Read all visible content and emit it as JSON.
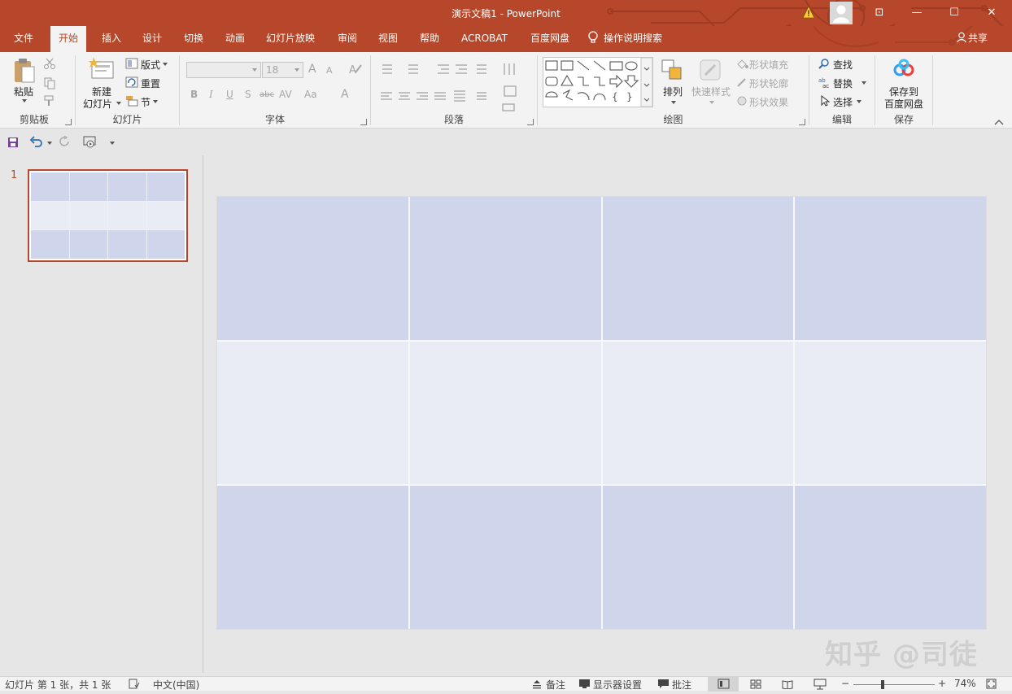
{
  "window": {
    "title": "演示文稿1  -  PowerPoint",
    "minimize": "—",
    "restore": "☐",
    "close": "✕",
    "ribbon_display": "⊡"
  },
  "tabs": [
    {
      "label": "文件",
      "active": false
    },
    {
      "label": "开始",
      "active": true
    },
    {
      "label": "插入",
      "active": false
    },
    {
      "label": "设计",
      "active": false
    },
    {
      "label": "切换",
      "active": false
    },
    {
      "label": "动画",
      "active": false
    },
    {
      "label": "幻灯片放映",
      "active": false
    },
    {
      "label": "审阅",
      "active": false
    },
    {
      "label": "视图",
      "active": false
    },
    {
      "label": "帮助",
      "active": false
    },
    {
      "label": "ACROBAT",
      "active": false
    },
    {
      "label": "百度网盘",
      "active": false
    }
  ],
  "tell_me": "操作说明搜索",
  "share": "共享",
  "ribbon": {
    "clipboard": {
      "paste": "粘贴",
      "group": "剪贴板"
    },
    "slides": {
      "new_slide": "新建",
      "new_slide2": "幻灯片",
      "layout": "版式",
      "reset": "重置",
      "section": "节",
      "group": "幻灯片"
    },
    "font": {
      "size": "18",
      "group": "字体",
      "bold": "B",
      "italic": "I",
      "underline": "U",
      "shadow": "S",
      "strike": "abc",
      "spacing": "AV",
      "case": "Aa",
      "grow": "A",
      "shrink": "A",
      "color": "A"
    },
    "paragraph": {
      "group": "段落"
    },
    "drawing": {
      "arrange": "排列",
      "quick_styles": "快速样式",
      "fill": "形状填充",
      "outline": "形状轮廓",
      "effects": "形状效果",
      "group": "绘图"
    },
    "editing": {
      "find": "查找",
      "replace": "替换",
      "select": "选择",
      "group": "编辑"
    },
    "save": {
      "label1": "保存到",
      "label2": "百度网盘",
      "group": "保存"
    }
  },
  "thumbnail_number": "1",
  "status": {
    "slide_info": "幻灯片 第 1 张，共 1 张",
    "language": "中文(中国)",
    "notes": "备注",
    "display": "显示器设置",
    "comments": "批注",
    "zoom": "74%"
  },
  "zoom_level": 0.74,
  "watermark": "知乎 @司徒",
  "colors": {
    "accent": "#b7472a",
    "cell_dark": "#cfd5ea",
    "cell_light": "#e9ebf5"
  }
}
